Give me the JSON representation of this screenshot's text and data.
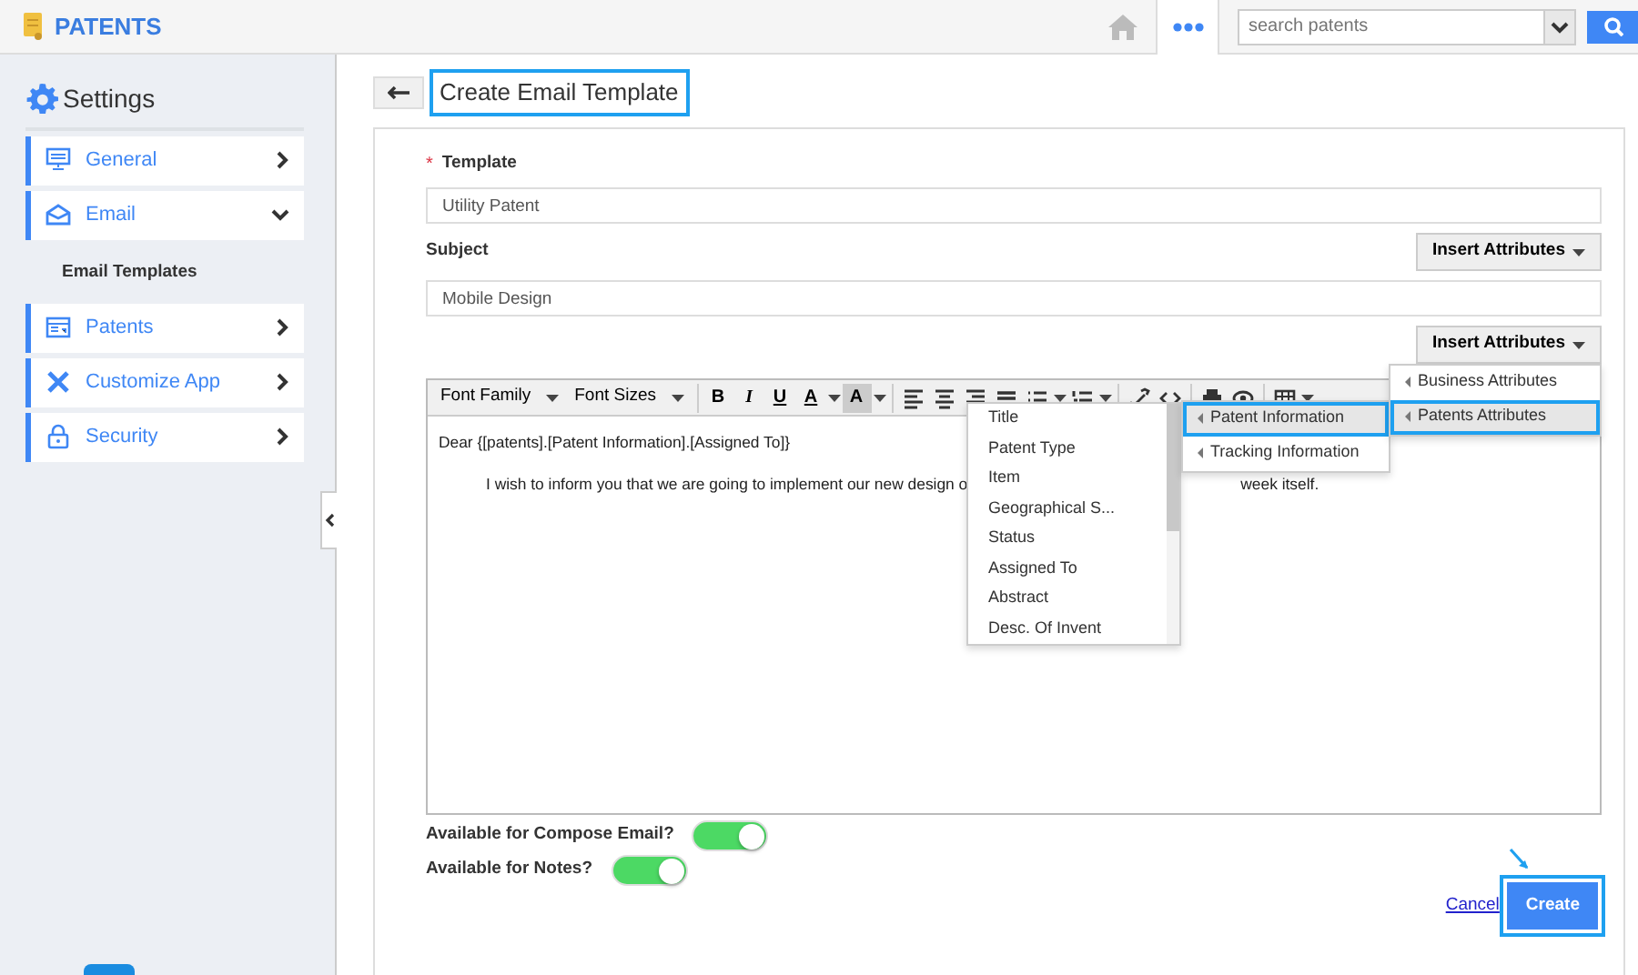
{
  "app": {
    "title": "PATENTS",
    "search": {
      "placeholder": "search patents"
    }
  },
  "sidebar": {
    "title": "Settings",
    "items": [
      {
        "label": "General",
        "expanded": false
      },
      {
        "label": "Email",
        "expanded": true,
        "children": [
          {
            "label": "Email Templates"
          }
        ]
      },
      {
        "label": "Patents",
        "expanded": false
      },
      {
        "label": "Customize App",
        "expanded": false
      },
      {
        "label": "Security",
        "expanded": false
      }
    ]
  },
  "page": {
    "title": "Create Email Template",
    "highlighted": true
  },
  "form": {
    "template": {
      "label": "Template",
      "required": true,
      "required_mark": "*",
      "value": "Utility Patent"
    },
    "subject": {
      "label": "Subject",
      "value": "Mobile Design",
      "button": "Insert Attributes"
    },
    "body_button": "Insert Attributes",
    "toolbar": [
      {
        "kind": "select",
        "label": "Font Family"
      },
      {
        "kind": "select",
        "label": "Font Sizes"
      },
      {
        "kind": "bold",
        "label": "B"
      },
      {
        "kind": "italic",
        "label": "I"
      },
      {
        "kind": "underline",
        "label": "U"
      },
      {
        "kind": "color",
        "label": "A"
      },
      {
        "kind": "highlight",
        "label": "A"
      }
    ],
    "body": {
      "greeting": "Dear {[patents].[Patent Information].[Assigned To]}",
      "line_start": "I wish to inform you that we are going to implement our new design o",
      "line_end": "week itself."
    },
    "attribute_menu": [
      {
        "label": "Business Attributes",
        "selected": false
      },
      {
        "label": "Patents Attributes",
        "selected": true
      }
    ],
    "attribute_submenu": [
      {
        "label": "Patent Information",
        "selected": true
      },
      {
        "label": "Tracking Information",
        "selected": false
      }
    ],
    "field_menu": [
      "Title",
      "Patent Type",
      "Item",
      "Geographical S...",
      "Status",
      "Assigned To",
      "Abstract",
      "Desc. Of Invent"
    ],
    "toggles": [
      {
        "label": "Available for Compose Email?",
        "on": true
      },
      {
        "label": "Available for Notes?",
        "on": true
      }
    ],
    "cancel": "Cancel",
    "create": {
      "label": "Create",
      "highlighted": true
    }
  }
}
